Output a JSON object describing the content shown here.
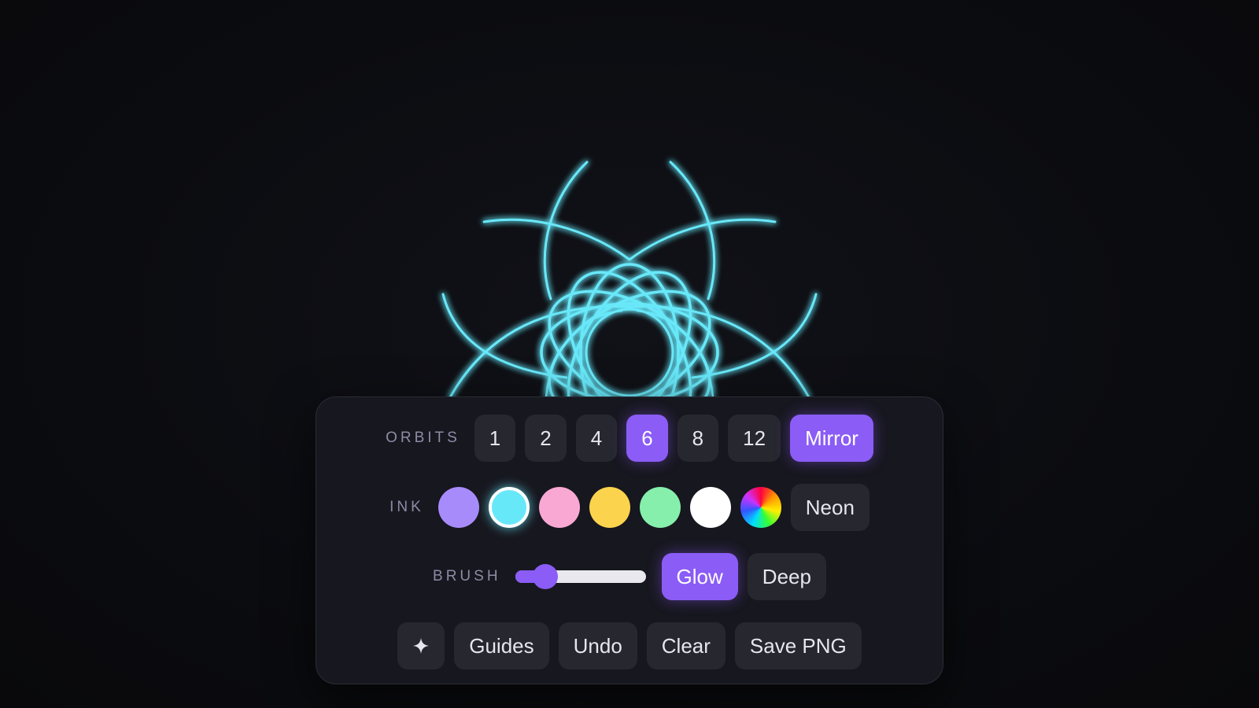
{
  "orbits": {
    "label": "ORBITS",
    "options": [
      "1",
      "2",
      "4",
      "6",
      "8",
      "12"
    ],
    "selected": "6",
    "mirror_label": "Mirror",
    "mirror_on": true
  },
  "ink": {
    "label": "INK",
    "swatches": [
      {
        "name": "lavender",
        "color": "#a78bfa"
      },
      {
        "name": "cyan",
        "color": "#67e8f9"
      },
      {
        "name": "pink",
        "color": "#f9a8d4"
      },
      {
        "name": "yellow",
        "color": "#fcd34d"
      },
      {
        "name": "green",
        "color": "#86efac"
      },
      {
        "name": "white",
        "color": "#ffffff"
      },
      {
        "name": "rainbow",
        "color": "conic"
      }
    ],
    "selected": "cyan",
    "neon_label": "Neon"
  },
  "brush": {
    "label": "BRUSH",
    "level": 0.23,
    "glow_label": "Glow",
    "glow_on": true,
    "deep_label": "Deep"
  },
  "actions": {
    "sparkle_icon": "sparkle-icon",
    "guides_label": "Guides",
    "undo_label": "Undo",
    "clear_label": "Clear",
    "save_label": "Save PNG"
  },
  "colors": {
    "accent": "#8b5cf6",
    "stroke": "#67e8f9",
    "background": "#0b0c10"
  }
}
